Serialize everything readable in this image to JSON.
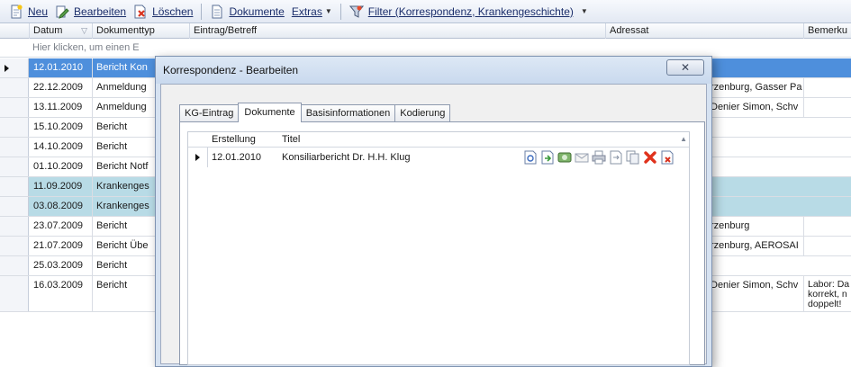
{
  "toolbar": {
    "new_label": "Neu",
    "edit_label": "Bearbeiten",
    "delete_label": "Löschen",
    "documents_label": "Dokumente",
    "extras_label": "Extras",
    "filter_label": "Filter (Korrespondenz, Krankengeschichte)"
  },
  "grid": {
    "columns": {
      "datum": "Datum",
      "dokumenttyp": "Dokumenttyp",
      "eintrag": "Eintrag/Betreff",
      "adressat": "Adressat",
      "bemerkung": "Bemerku"
    },
    "new_row_text": "Hier klicken, um einen E",
    "rows": [
      {
        "date": "12.01.2010",
        "type": "Bericht Kon",
        "addr": "",
        "note": ""
      },
      {
        "date": "22.12.2009",
        "type": "Anmeldung",
        "addr": "rzenburg, Gasser Pa",
        "note": ""
      },
      {
        "date": "13.11.2009",
        "type": "Anmeldung",
        "addr": "Denier Simon, Schv",
        "note": ""
      },
      {
        "date": "15.10.2009",
        "type": "Bericht",
        "addr": "",
        "note": ""
      },
      {
        "date": "14.10.2009",
        "type": "Bericht",
        "addr": "",
        "note": ""
      },
      {
        "date": "01.10.2009",
        "type": "Bericht Notf",
        "addr": "",
        "note": ""
      },
      {
        "date": "11.09.2009",
        "type": "Krankenges",
        "addr": "",
        "note": ""
      },
      {
        "date": "03.08.2009",
        "type": "Krankenges",
        "addr": "",
        "note": ""
      },
      {
        "date": "23.07.2009",
        "type": "Bericht",
        "addr": "rzenburg",
        "note": ""
      },
      {
        "date": "21.07.2009",
        "type": "Bericht Übe",
        "addr": "rzenburg, AEROSAI",
        "note": ""
      },
      {
        "date": "25.03.2009",
        "type": "Bericht",
        "addr": "",
        "note": ""
      },
      {
        "date": "16.03.2009",
        "type": "Bericht",
        "addr": "Denier Simon, Schv",
        "note": "Labor: Da korrekt, n doppelt!"
      }
    ]
  },
  "dialog": {
    "title": "Korrespondenz - Bearbeiten",
    "close_glyph": "✕",
    "tabs": [
      "KG-Eintrag",
      "Dokumente",
      "Basisinformationen",
      "Kodierung"
    ],
    "active_tab": "Dokumente",
    "doc_columns": {
      "erstellung": "Erstellung",
      "titel": "Titel"
    },
    "documents": [
      {
        "erstellung": "12.01.2010",
        "titel": "Konsiliarbericht Dr. H.H. Klug"
      }
    ]
  },
  "colors": {
    "selected_row": "#4e8fdc",
    "highlight_row": "#b8dbe6",
    "delete_red": "#e0321c"
  }
}
